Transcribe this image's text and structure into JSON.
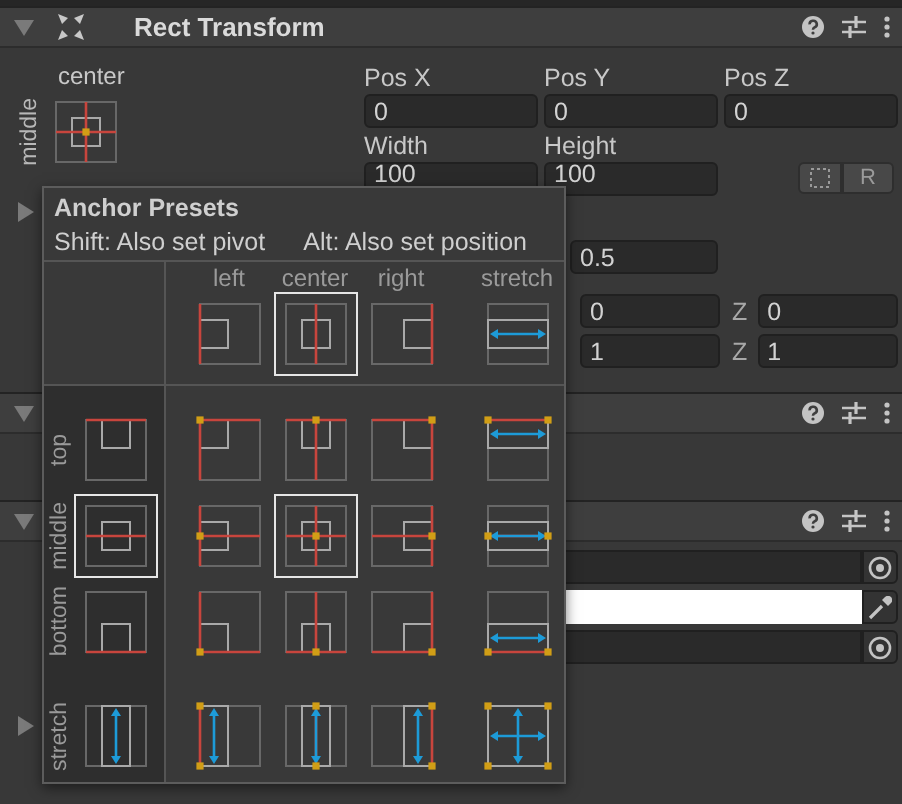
{
  "component": {
    "title": "Rect Transform"
  },
  "anchor_widget": {
    "horizontal": "center",
    "vertical": "middle"
  },
  "position_fields": [
    {
      "label": "Pos X",
      "value": "0"
    },
    {
      "label": "Pos Y",
      "value": "0"
    },
    {
      "label": "Pos Z",
      "value": "0"
    }
  ],
  "size_fields": [
    {
      "label": "Width",
      "value": "100"
    },
    {
      "label": "Height",
      "value": "100"
    }
  ],
  "raw_edit_button": "R",
  "partly_covered_rows": [
    {
      "fields": [
        {
          "value": "0.5"
        }
      ]
    },
    {
      "fields": [
        {
          "value": "0"
        },
        {
          "label": "Z",
          "value": "0"
        }
      ]
    },
    {
      "fields": [
        {
          "value": "1"
        },
        {
          "label": "Z",
          "value": "1"
        }
      ]
    }
  ],
  "object_fields": [
    {
      "kind": "object"
    },
    {
      "kind": "color",
      "color": "#ffffff"
    },
    {
      "kind": "object"
    }
  ],
  "popup": {
    "title": "Anchor Presets",
    "hints": [
      "Shift: Also set pivot",
      "Alt: Also set position"
    ],
    "columns": [
      {
        "label": "left",
        "kind": "left",
        "selected": false
      },
      {
        "label": "center",
        "kind": "center",
        "selected": true
      },
      {
        "label": "right",
        "kind": "right",
        "selected": false
      },
      {
        "label": "stretch",
        "kind": "stretch",
        "selected": false
      }
    ],
    "rows": [
      {
        "label": "top",
        "kind": "top",
        "selected": false,
        "cells": [
          {
            "selected": false
          },
          {
            "selected": false
          },
          {
            "selected": false
          },
          {
            "selected": false
          }
        ]
      },
      {
        "label": "middle",
        "kind": "middle",
        "selected": true,
        "cells": [
          {
            "selected": false
          },
          {
            "selected": true
          },
          {
            "selected": false
          },
          {
            "selected": false
          }
        ]
      },
      {
        "label": "bottom",
        "kind": "bottom",
        "selected": false,
        "cells": [
          {
            "selected": false
          },
          {
            "selected": false
          },
          {
            "selected": false
          },
          {
            "selected": false
          }
        ]
      },
      {
        "label": "stretch",
        "kind": "stretch",
        "selected": false,
        "cells": [
          {
            "selected": false
          },
          {
            "selected": false
          },
          {
            "selected": false
          },
          {
            "selected": false
          }
        ]
      }
    ]
  }
}
